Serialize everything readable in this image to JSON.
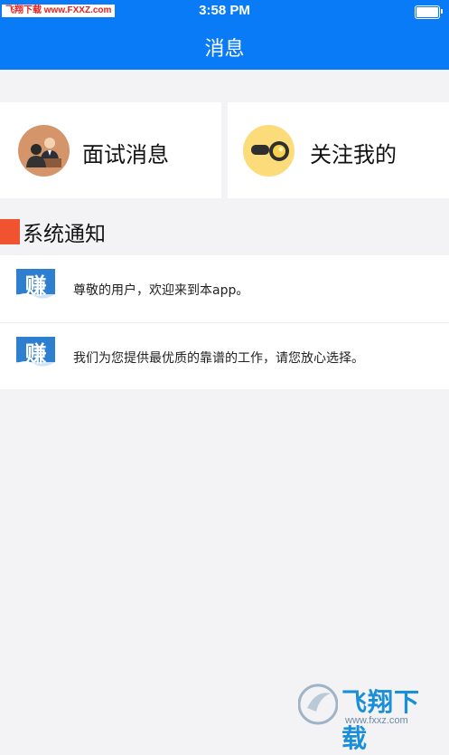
{
  "status_bar": {
    "watermark": "飞翔下载 www.FXXZ.com",
    "time": "3:58 PM"
  },
  "nav": {
    "title": "消息"
  },
  "cards": [
    {
      "label": "面试消息",
      "icon": "interview-icon"
    },
    {
      "label": "关注我的",
      "icon": "binoculars-icon"
    }
  ],
  "section": {
    "title": "系统通知",
    "accent_color": "#f0532f"
  },
  "notices": [
    {
      "text": "尊敬的用户，欢迎来到本app。",
      "icon": "app-logo-icon",
      "logo_char": "赚"
    },
    {
      "text": "我们为您提供最优质的靠谱的工作，请您放心选择。",
      "icon": "app-logo-icon",
      "logo_char": "赚"
    }
  ],
  "watermark_logo": {
    "text": "飞翔下载",
    "url": "www.fxxz.com"
  },
  "colors": {
    "brand_blue": "#0a7bf7",
    "background": "#f3f3f5"
  }
}
